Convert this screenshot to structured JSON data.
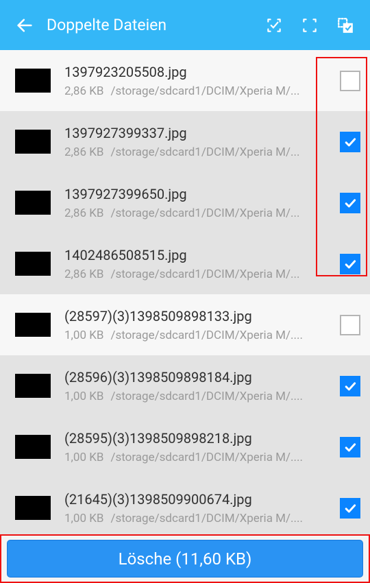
{
  "header": {
    "title": "Doppelte Dateien"
  },
  "files": [
    {
      "name": "1397923205508.jpg",
      "size": "2,86 KB",
      "path": "/storage/sdcard1/DCIM/Xperia M/...",
      "checked": false,
      "group": 0
    },
    {
      "name": "1397927399337.jpg",
      "size": "2,86 KB",
      "path": "/storage/sdcard1/DCIM/Xperia M/...",
      "checked": true,
      "group": 0
    },
    {
      "name": "1397927399650.jpg",
      "size": "2,86 KB",
      "path": "/storage/sdcard1/DCIM/Xperia M/...",
      "checked": true,
      "group": 0
    },
    {
      "name": "1402486508515.jpg",
      "size": "2,86 KB",
      "path": "/storage/sdcard1/DCIM/Xperia M/...",
      "checked": true,
      "group": 0
    },
    {
      "name": "(28597)(3)1398509898133.jpg",
      "size": "1,00 KB",
      "path": "/storage/sdcard1/DCIM/Xperia M/....",
      "checked": false,
      "group": 1
    },
    {
      "name": "(28596)(3)1398509898184.jpg",
      "size": "1,00 KB",
      "path": "/storage/sdcard1/DCIM/Xperia M/....",
      "checked": true,
      "group": 1
    },
    {
      "name": "(28595)(3)1398509898218.jpg",
      "size": "1,00 KB",
      "path": "/storage/sdcard1/DCIM/Xperia M/....",
      "checked": true,
      "group": 1
    },
    {
      "name": "(21645)(3)1398509900674.jpg",
      "size": "1,00 KB",
      "path": "/storage/sdcard1/DCIM/Xperia M/....",
      "checked": true,
      "group": 1
    }
  ],
  "footer": {
    "delete_label": "Lösche (11,60 KB)"
  }
}
